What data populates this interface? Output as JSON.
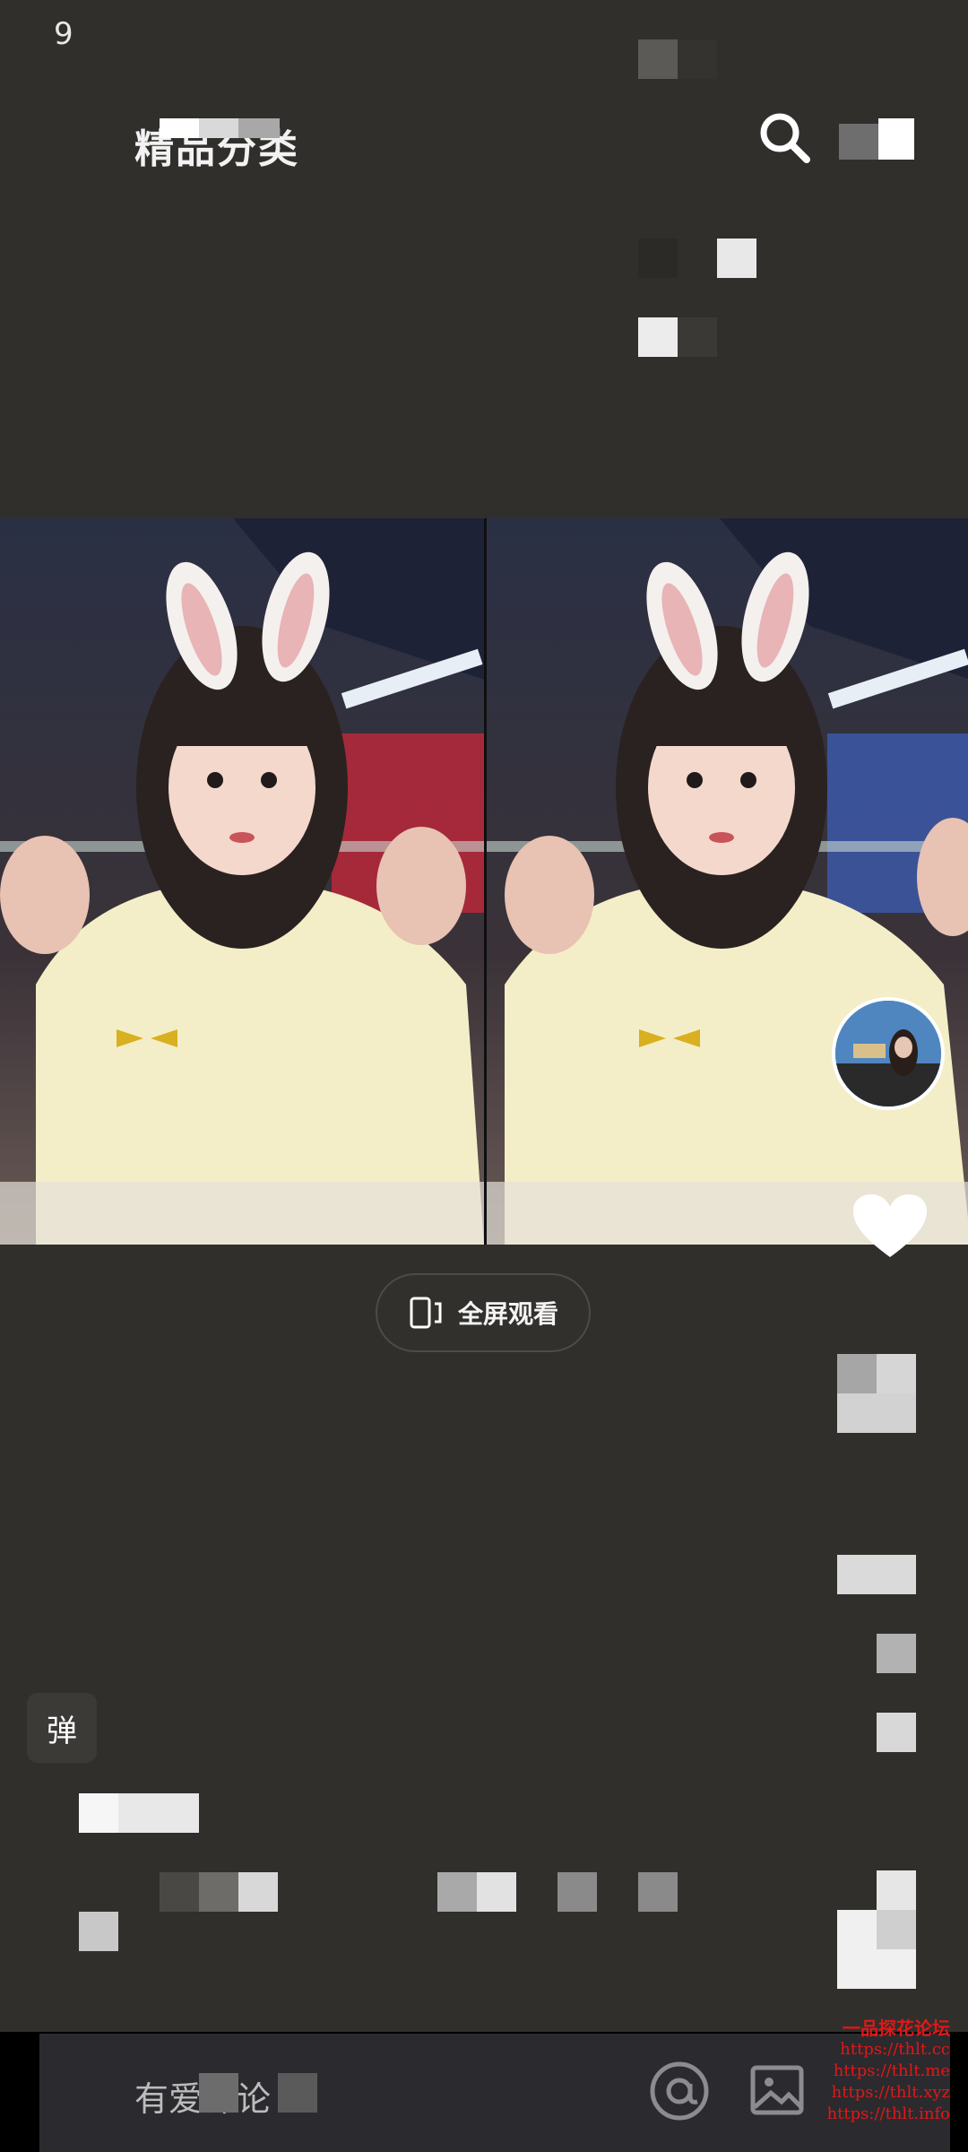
{
  "status_bar": {
    "time": "9"
  },
  "top_bar": {
    "title": "精品分类"
  },
  "video": {
    "fullscreen_label": "全屏观看"
  },
  "danmu": {
    "label": "弹"
  },
  "comment_bar": {
    "placeholder": "有爱评论"
  },
  "watermark": {
    "title": "一品探花论坛",
    "lines": [
      "https://thlt.cc",
      "https://thlt.me",
      "https://thlt.xyz",
      "https://thlt.info"
    ]
  },
  "colors": {
    "background": "#312f2c",
    "comment_bar": "#2b2a2e",
    "watermark": "#e01818"
  }
}
